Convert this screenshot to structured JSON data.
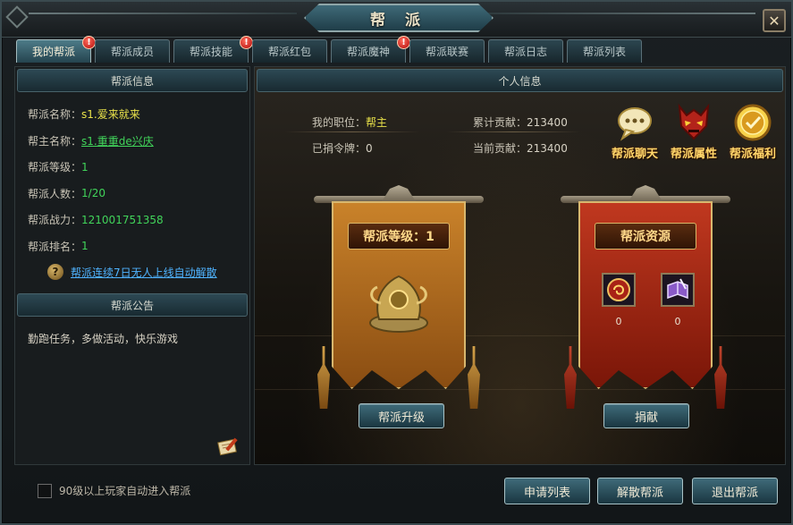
{
  "window": {
    "title": "帮 派",
    "close_label": "✕"
  },
  "tabs": [
    {
      "label": "我的帮派",
      "active": true,
      "alert": true
    },
    {
      "label": "帮派成员",
      "active": false,
      "alert": false
    },
    {
      "label": "帮派技能",
      "active": false,
      "alert": true
    },
    {
      "label": "帮派红包",
      "active": false,
      "alert": false
    },
    {
      "label": "帮派魔神",
      "active": false,
      "alert": true
    },
    {
      "label": "帮派联赛",
      "active": false,
      "alert": false
    },
    {
      "label": "帮派日志",
      "active": false,
      "alert": false
    },
    {
      "label": "帮派列表",
      "active": false,
      "alert": false
    }
  ],
  "badge_glyph": "!",
  "guild_info": {
    "header": "帮派信息",
    "rows": [
      {
        "key": "帮派名称：",
        "value": "s1.爱来就来"
      },
      {
        "key": "帮主名称：",
        "value": "s1.重重de兴庆"
      },
      {
        "key": "帮派等级：",
        "value": "1"
      },
      {
        "key": "帮派人数：",
        "value": "1/20"
      },
      {
        "key": "帮派战力：",
        "value": "121001751358"
      },
      {
        "key": "帮派排名：",
        "value": "1"
      }
    ],
    "help_glyph": "?",
    "dissolve_notice": "帮派连续7日无人上线自动解散"
  },
  "announcement": {
    "header": "帮派公告",
    "text": "勤跑任务，多做活动，快乐游戏"
  },
  "personal_info": {
    "header": "个人信息",
    "position_label": "我的职位：",
    "position_value": "帮主",
    "total_contrib_label": "累计贡献：",
    "total_contrib_value": "213400",
    "tokens_label": "已捐令牌：",
    "tokens_value": "0",
    "current_contrib_label": "当前贡献：",
    "current_contrib_value": "213400"
  },
  "features": [
    {
      "label": "帮派聊天",
      "icon": "chat-bubble-icon"
    },
    {
      "label": "帮派属性",
      "icon": "demon-mask-icon"
    },
    {
      "label": "帮派福利",
      "icon": "gold-medal-icon"
    }
  ],
  "level_banner": {
    "title": "帮派等级：1",
    "emblem": "golden-dragon-emblem-icon",
    "button": "帮派升级"
  },
  "resource_banner": {
    "title": "帮派资源",
    "items": [
      {
        "icon": "red-seal-token-icon",
        "count": "0"
      },
      {
        "icon": "purple-book-icon",
        "count": "0"
      }
    ],
    "button": "捐献"
  },
  "bottom": {
    "auto_join_label": "90级以上玩家自动进入帮派",
    "apply_list": "申请列表",
    "disband": "解散帮派",
    "leave": "退出帮派"
  },
  "colors": {
    "accent_teal": "#3f6b7a",
    "value_yellow": "#e8e14a",
    "value_green": "#41d45a",
    "link_blue": "#4fb3ff",
    "feature_gold": "#ffd76b",
    "alert_red": "#b20c0c"
  }
}
